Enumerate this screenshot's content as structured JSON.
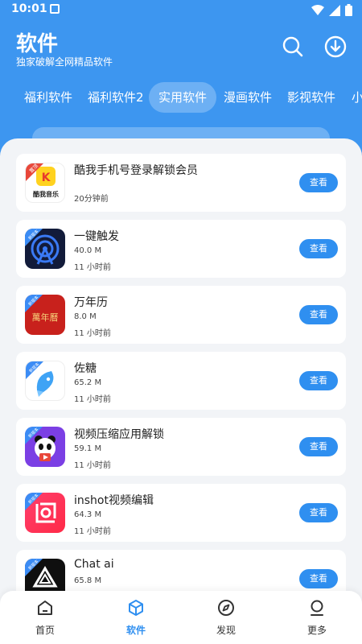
{
  "status": {
    "time": "10:01"
  },
  "header": {
    "title": "软件",
    "subtitle": "独家破解全网精品软件"
  },
  "tabs": [
    {
      "label": "福利软件"
    },
    {
      "label": "福利软件2"
    },
    {
      "label": "实用软件"
    },
    {
      "label": "漫画软件"
    },
    {
      "label": "影视软件"
    },
    {
      "label": "小"
    }
  ],
  "apps": [
    {
      "name": "酷我手机号登录解锁会员",
      "size": "",
      "time": "20分钟前",
      "badge": "置顶",
      "button": "查看"
    },
    {
      "name": "一键触发",
      "size": "40.0 M",
      "time": "11 小时前",
      "badge": "新版本",
      "button": "查看"
    },
    {
      "name": "万年历",
      "size": "8.0 M",
      "time": "11 小时前",
      "badge": "新版本",
      "button": "查看"
    },
    {
      "name": "佐糖",
      "size": "65.2 M",
      "time": "11 小时前",
      "badge": "新版本",
      "button": "查看"
    },
    {
      "name": "视频压缩应用解锁",
      "size": "59.1 M",
      "time": "11 小时前",
      "badge": "新版本",
      "button": "查看"
    },
    {
      "name": "inshot视频编辑",
      "size": "64.3 M",
      "time": "11 小时前",
      "badge": "新版本",
      "button": "查看"
    },
    {
      "name": "Chat ai",
      "size": "65.8 M",
      "time": "",
      "badge": "新版本",
      "button": "查看"
    }
  ],
  "kuwo_logo_text": "酷我音乐",
  "calendar_logo_text": "萬年曆",
  "nav": [
    {
      "label": "首页"
    },
    {
      "label": "软件"
    },
    {
      "label": "发现"
    },
    {
      "label": "更多"
    }
  ],
  "colors": {
    "primary": "#3d96f0",
    "button": "#2f8ff0",
    "background": "#f2f4f7"
  }
}
